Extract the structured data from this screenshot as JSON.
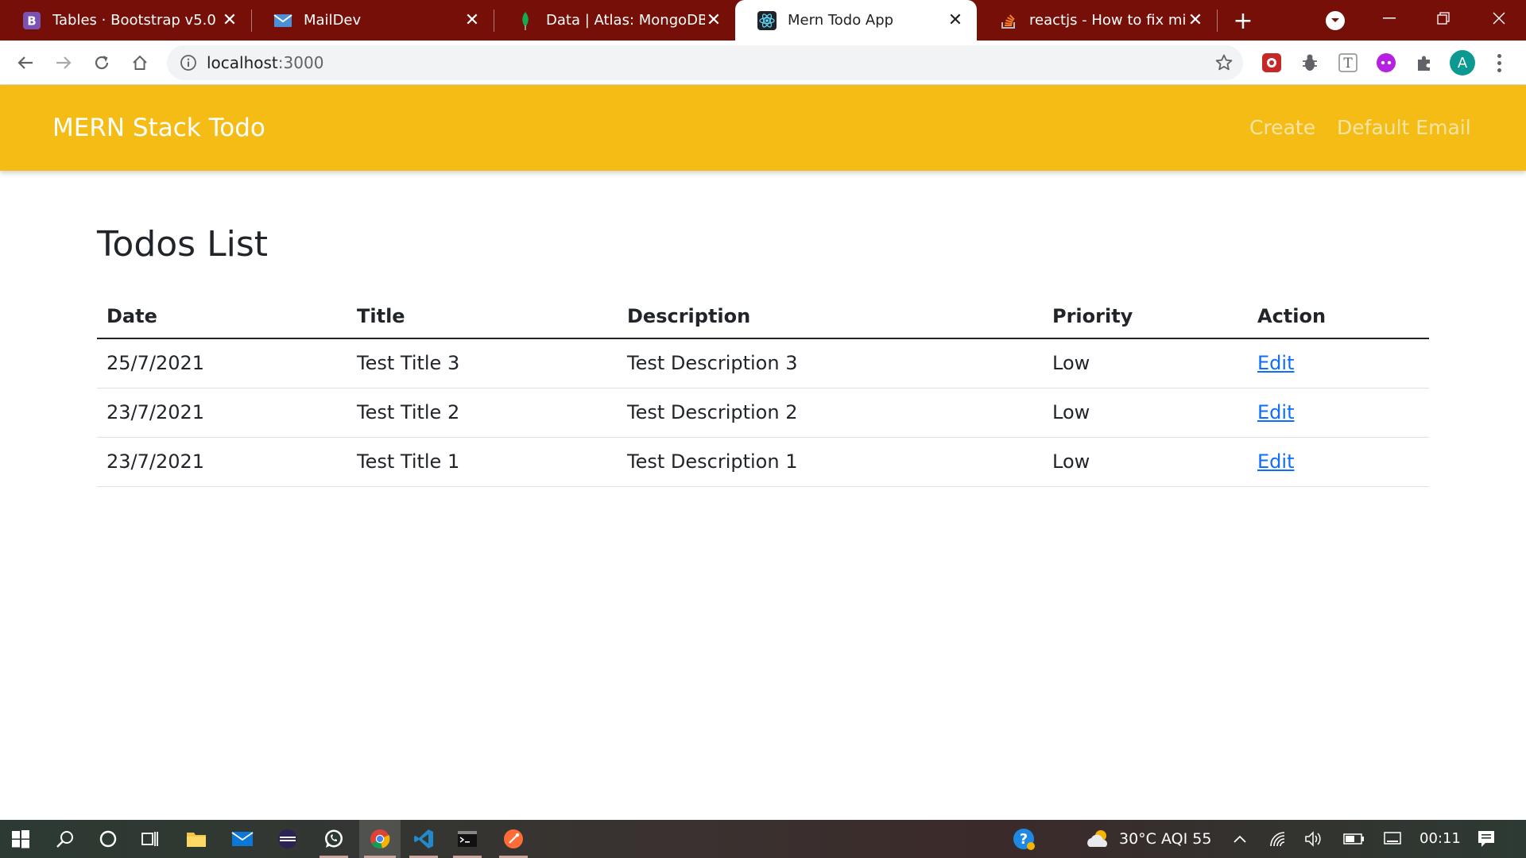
{
  "browser": {
    "tabs": [
      {
        "title": "Tables · Bootstrap v5.0",
        "icon": "bootstrap-icon"
      },
      {
        "title": "MailDev",
        "icon": "mail-icon"
      },
      {
        "title": "Data | Atlas: MongoDB Atl",
        "icon": "mongodb-leaf-icon"
      },
      {
        "title": "Mern Todo App",
        "icon": "react-icon",
        "active": true
      },
      {
        "title": "reactjs - How to fix missin",
        "icon": "stackoverflow-icon"
      }
    ],
    "url_host": "localhost",
    "url_port": ":3000",
    "profile_initial": "A"
  },
  "navbar": {
    "brand": "MERN Stack Todo",
    "links": [
      "Create",
      "Default Email"
    ],
    "color": "#f5bc16"
  },
  "page": {
    "title": "Todos List",
    "columns": [
      "Date",
      "Title",
      "Description",
      "Priority",
      "Action"
    ],
    "rows": [
      {
        "date": "25/7/2021",
        "title": "Test Title 3",
        "description": "Test Description 3",
        "priority": "Low",
        "action": "Edit"
      },
      {
        "date": "23/7/2021",
        "title": "Test Title 2",
        "description": "Test Description 2",
        "priority": "Low",
        "action": "Edit"
      },
      {
        "date": "23/7/2021",
        "title": "Test Title 1",
        "description": "Test Description 1",
        "priority": "Low",
        "action": "Edit"
      }
    ],
    "link_color": "#0d6efd"
  },
  "taskbar": {
    "weather": "30°C  AQI 55",
    "time": "00:11"
  }
}
